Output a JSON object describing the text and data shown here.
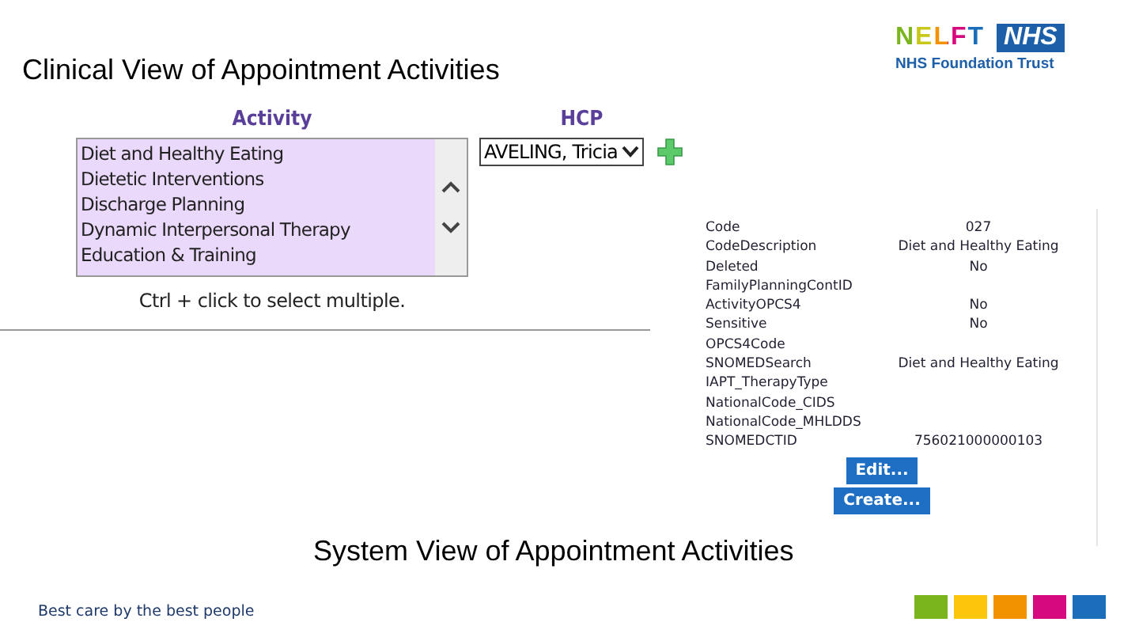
{
  "title": "Clinical View of Appointment Activities",
  "logo": {
    "brand": "NELFT",
    "badge": "NHS",
    "subtitle": "NHS Foundation Trust"
  },
  "clinical_view": {
    "activity_label": "Activity",
    "hcp_label": "HCP",
    "activities": [
      {
        "label": "Diet and Healthy Eating",
        "selected": false
      },
      {
        "label": "Dietetic Interventions",
        "selected": false
      },
      {
        "label": "Discharge Planning",
        "selected": false
      },
      {
        "label": "Dynamic Interpersonal Therapy",
        "selected": false
      },
      {
        "label": "Education & Training",
        "selected": false
      }
    ],
    "hcp_value": "AVELING, Tricia",
    "hint": "Ctrl + click to select multiple."
  },
  "system_view": {
    "fields": [
      {
        "name": "Code",
        "value": "027"
      },
      {
        "name": "CodeDescription",
        "value": "Diet and Healthy Eating"
      },
      {
        "name": "Deleted",
        "value": "No"
      },
      {
        "name": "FamilyPlanningContID"
      },
      {
        "name": "ActivityOPCS4",
        "value": "No"
      },
      {
        "name": "Sensitive",
        "value": "No"
      },
      {
        "name": "OPCS4Code"
      },
      {
        "name": "SNOMEDSearch",
        "value": "Diet and Healthy Eating"
      },
      {
        "name": "IAPT_TherapyType"
      },
      {
        "name": "NationalCode_CIDS"
      },
      {
        "name": "NationalCode_MHLDDS"
      },
      {
        "name": "SNOMEDCTID",
        "value": "756021000000103"
      }
    ],
    "buttons": [
      "Edit...",
      "Create..."
    ]
  },
  "caption": "System View of Appointment Activities",
  "footer": {
    "tagline": "Best care by the best people",
    "swatches": [
      {
        "color": "#7ab51d"
      },
      {
        "color": "#fcc60d"
      },
      {
        "color": "#f39200"
      },
      {
        "color": "#d6097e"
      },
      {
        "color": "#1b6fba"
      }
    ]
  }
}
